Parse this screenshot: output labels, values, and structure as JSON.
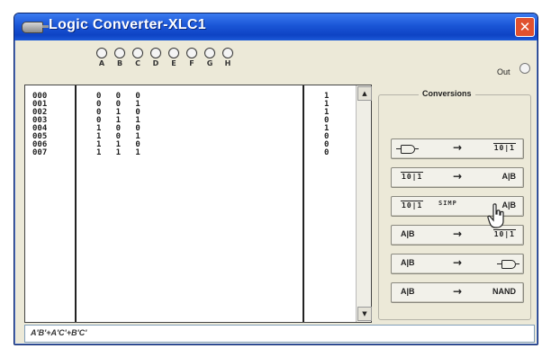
{
  "window": {
    "title": "Logic Converter-XLC1",
    "close_label": "✕"
  },
  "inputs": [
    "A",
    "B",
    "C",
    "D",
    "E",
    "F",
    "G",
    "H"
  ],
  "output_label": "Out",
  "truth_table": {
    "row_index": [
      "000",
      "001",
      "002",
      "003",
      "004",
      "005",
      "006",
      "007"
    ],
    "bits": [
      "0   0   0",
      "0   0   1",
      "0   1   0",
      "0   1   1",
      "1   0   0",
      "1   0   1",
      "1   1   0",
      "1   1   1"
    ],
    "outputs": [
      "1",
      "1",
      "1",
      "0",
      "1",
      "0",
      "0",
      "0"
    ]
  },
  "scroll": {
    "up": "▲",
    "down": "▼"
  },
  "conversions": {
    "title": "Conversions",
    "arrow": "→",
    "simp": "SIMP",
    "truth_table_icon": "10|1",
    "buttons": [
      {
        "from": "gate",
        "to": "truth-table"
      },
      {
        "from": "truth-table",
        "to": "A|B"
      },
      {
        "from": "truth-table",
        "to": "A|B",
        "simp": true
      },
      {
        "from": "A|B",
        "to": "truth-table"
      },
      {
        "from": "A|B",
        "to": "gate"
      },
      {
        "from": "A|B",
        "to": "NAND"
      }
    ]
  },
  "expression": "A'B'+A'C'+B'C'"
}
